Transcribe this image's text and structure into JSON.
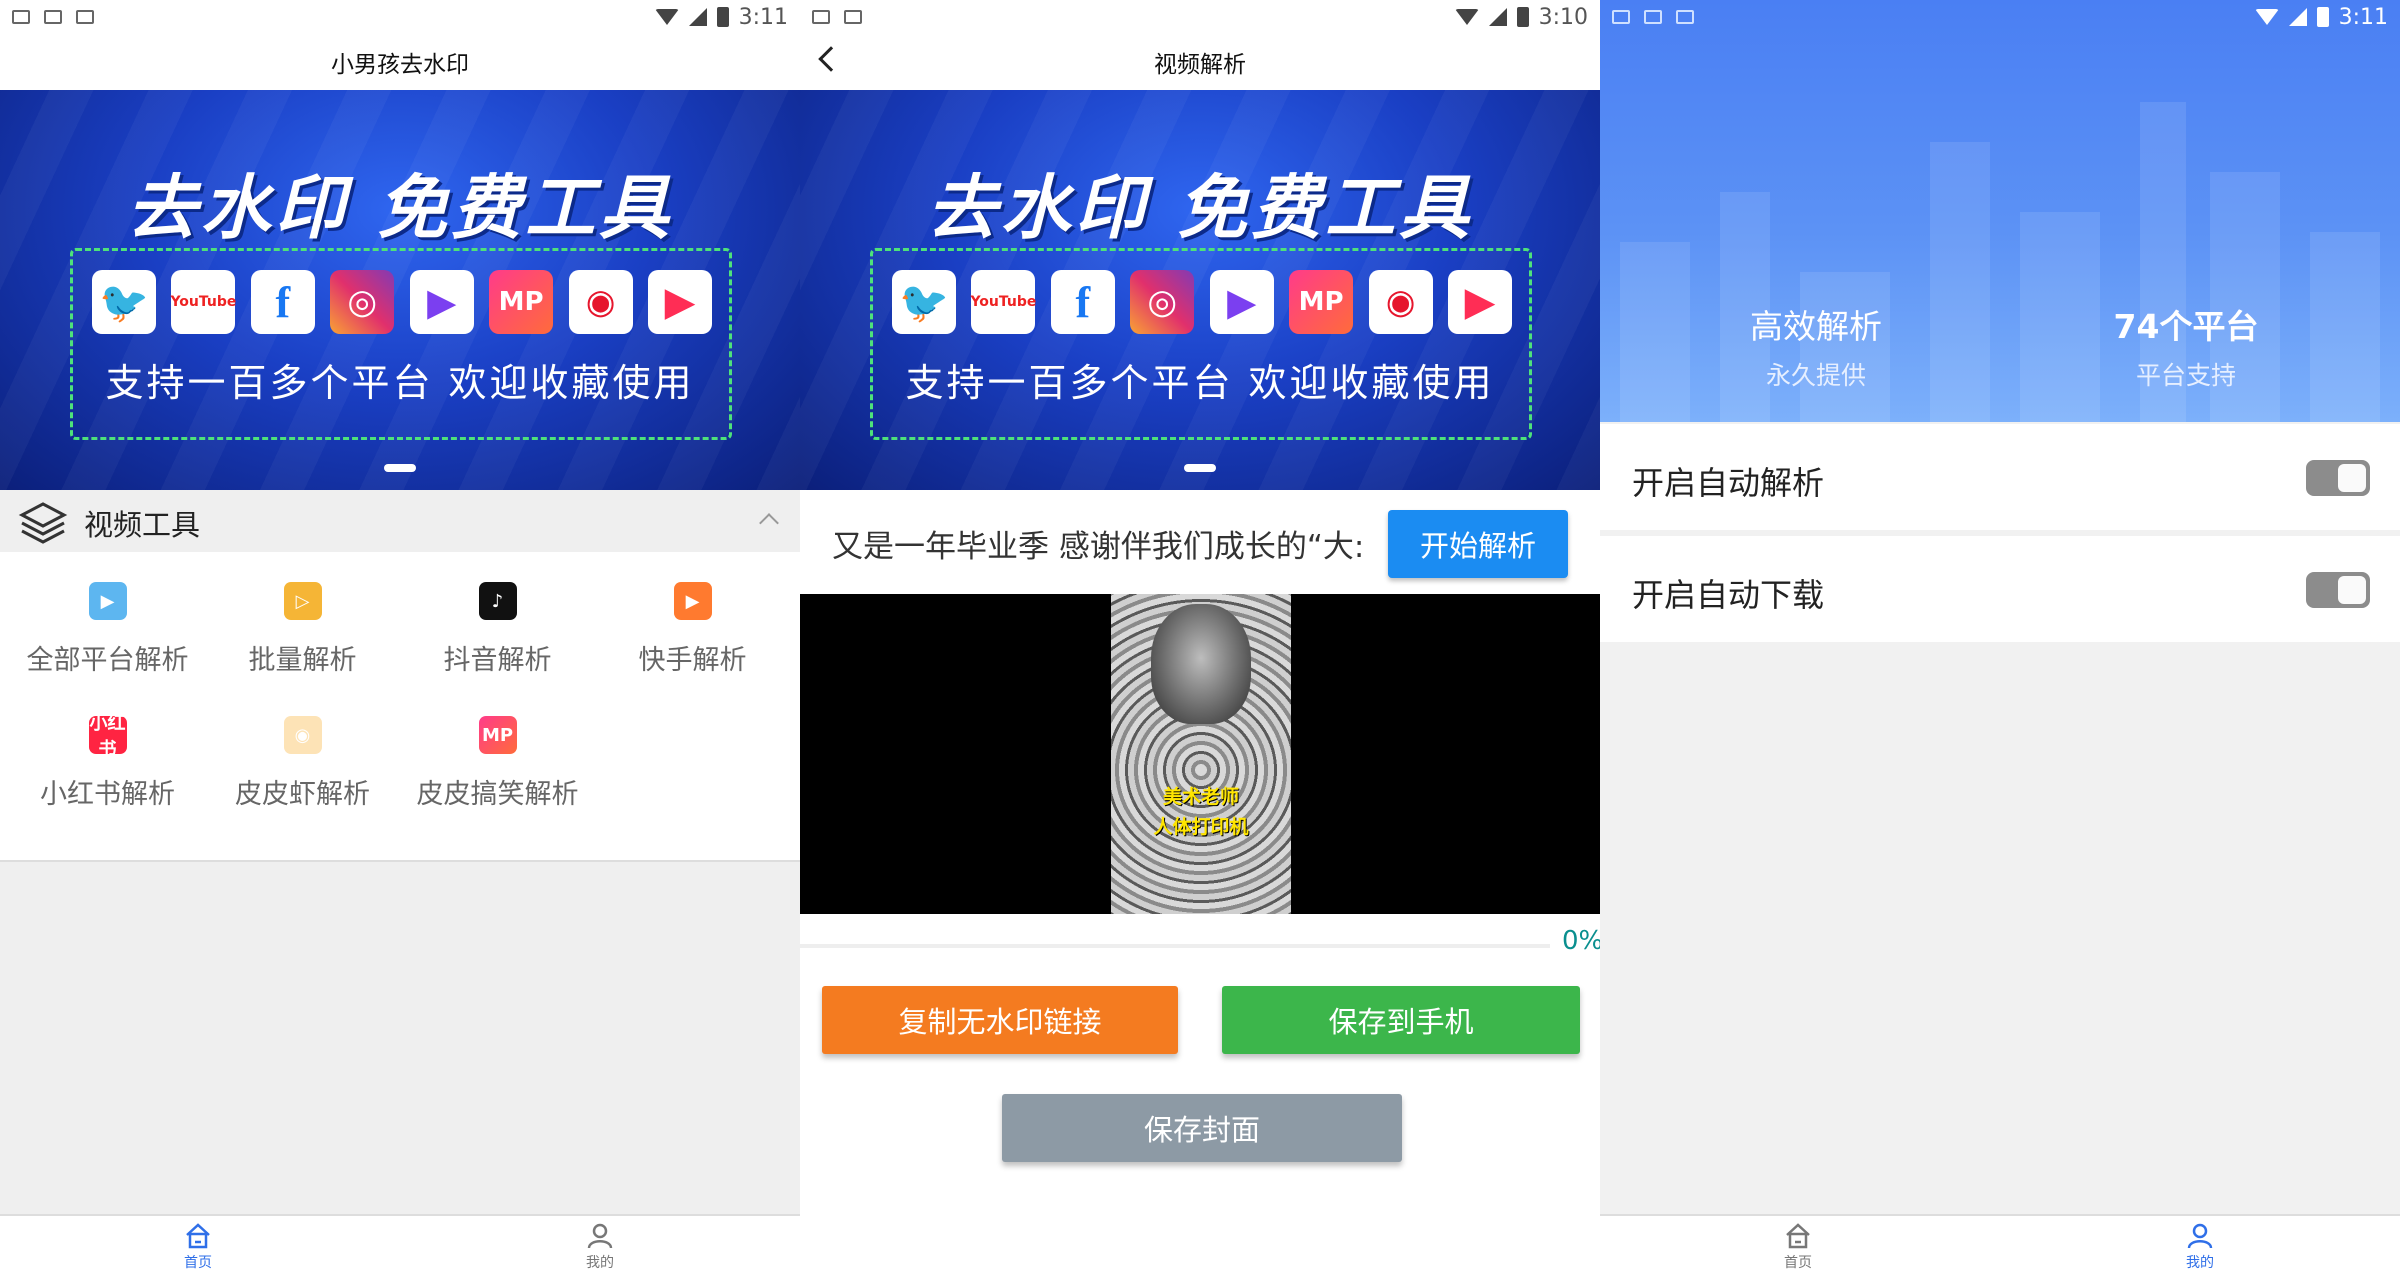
{
  "statusbar": {
    "time_p1": "3:11",
    "time_p2": "3:10",
    "time_p3": "3:11"
  },
  "banner": {
    "title": "去水印 免费工具",
    "subtitle": "支持一百多个平台  欢迎收藏使用",
    "icons": [
      "twitter-icon",
      "youtube-icon",
      "facebook-icon",
      "instagram-icon",
      "play-icon",
      "mp-icon",
      "weibo-icon",
      "kuaishou-icon"
    ],
    "youtube_text": "YouTube",
    "mp_text": "MP"
  },
  "home": {
    "title": "小男孩去水印",
    "section_title": "视频工具",
    "tools": [
      {
        "label": "全部平台解析",
        "icon": "video-icon"
      },
      {
        "label": "批量解析",
        "icon": "batch-icon"
      },
      {
        "label": "抖音解析",
        "icon": "douyin-icon"
      },
      {
        "label": "快手解析",
        "icon": "kuaishou-icon"
      },
      {
        "label": "小红书解析",
        "icon": "xiaohongshu-icon",
        "icon_text": "小红书"
      },
      {
        "label": "皮皮虾解析",
        "icon": "pipixia-icon"
      },
      {
        "label": "皮皮搞笑解析",
        "icon": "pipigaoxiao-icon",
        "icon_text": "MP"
      }
    ]
  },
  "parse": {
    "title": "视频解析",
    "input_value": "又是一年毕业季 感谢伴我们成长的“大:",
    "start_button": "开始解析",
    "video_caption_line1": "美术老师",
    "video_caption_line2": "人体打印机",
    "progress_percent": 0,
    "progress_text": "0%",
    "copy_button": "复制无水印链接",
    "save_button": "保存到手机",
    "cover_button": "保存封面"
  },
  "profile": {
    "stats": [
      {
        "value": "高效解析",
        "label": "永久提供"
      },
      {
        "value": "74个平台",
        "label": "平台支持"
      }
    ],
    "settings": [
      {
        "label": "开启自动解析",
        "enabled": true
      },
      {
        "label": "开启自动下载",
        "enabled": true
      }
    ]
  },
  "nav": {
    "home_label": "首页",
    "mine_label": "我的"
  },
  "colors": {
    "accent": "#2f6fe8",
    "start_button": "#1b8cf2",
    "copy_button": "#f47b20",
    "save_button": "#3cb64b",
    "cover_button": "#8d9aa5"
  }
}
